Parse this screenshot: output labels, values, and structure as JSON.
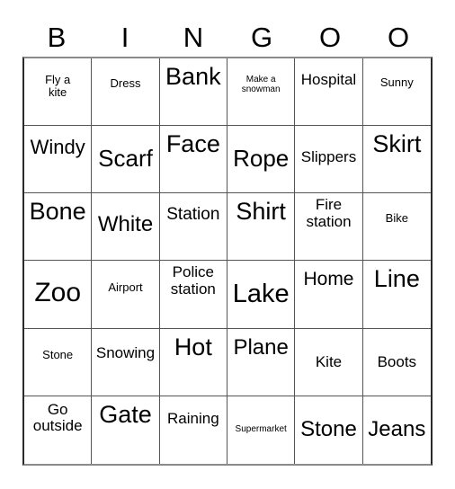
{
  "header": {
    "letters": [
      "B",
      "I",
      "N",
      "G",
      "O",
      "O"
    ]
  },
  "board": {
    "rows": [
      [
        "Fly a kite",
        "Dress",
        "Bank",
        "Make a snowman",
        "Hospital",
        "Sunny"
      ],
      [
        "Windy",
        "Scarf",
        "Face",
        "Rope",
        "Slippers",
        "Skirt"
      ],
      [
        "Bone",
        "White",
        "Station",
        "Shirt",
        "Fire station",
        "Bike"
      ],
      [
        "Zoo",
        "Airport",
        "Police station",
        "Lake",
        "Home",
        "Line"
      ],
      [
        "Stone",
        "Snowing",
        "Hot",
        "Plane",
        "Kite",
        "Boots"
      ],
      [
        "Go outside",
        "Gate",
        "Raining",
        "Supermarket",
        "Stone",
        "Jeans"
      ]
    ]
  }
}
